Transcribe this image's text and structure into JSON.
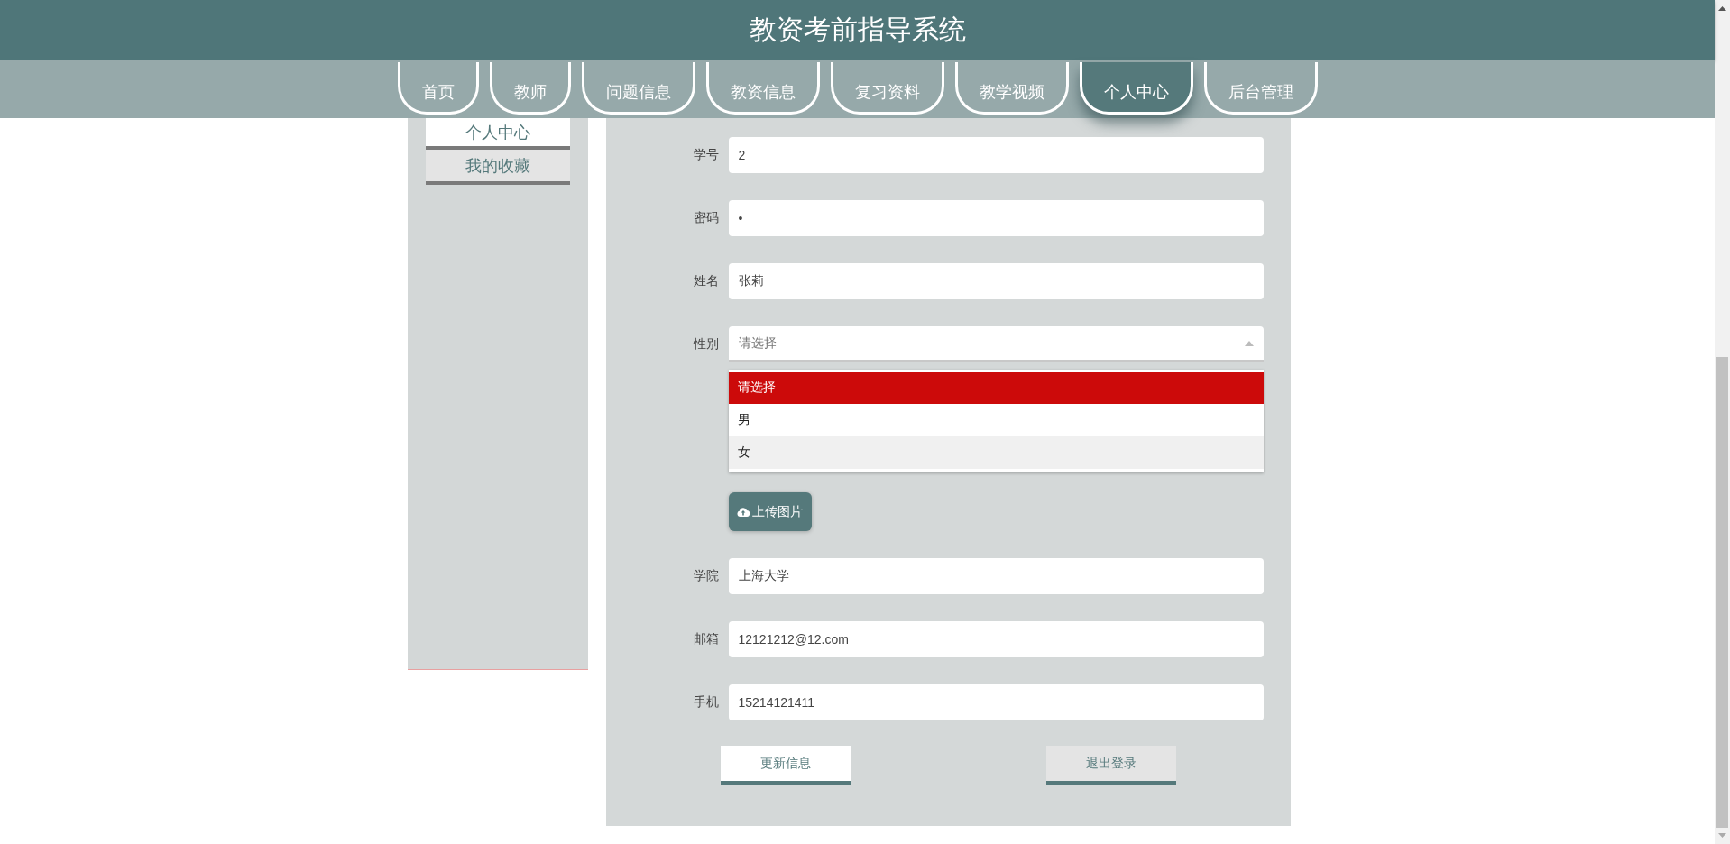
{
  "header": {
    "title": "教资考前指导系统"
  },
  "nav": [
    {
      "label": "首页",
      "selected": false
    },
    {
      "label": "教师",
      "selected": false
    },
    {
      "label": "问题信息",
      "selected": false
    },
    {
      "label": "教资信息",
      "selected": false
    },
    {
      "label": "复习资料",
      "selected": false
    },
    {
      "label": "教学视频",
      "selected": false
    },
    {
      "label": "个人中心",
      "selected": true
    },
    {
      "label": "后台管理",
      "selected": false
    }
  ],
  "sidebar": [
    {
      "label": "个人中心",
      "selected": true
    },
    {
      "label": "我的收藏",
      "selected": false
    }
  ],
  "form": {
    "fields": [
      {
        "kind": "text",
        "label": "学号",
        "value": "2"
      },
      {
        "kind": "text",
        "label": "密码",
        "value": "•"
      },
      {
        "kind": "text",
        "label": "姓名",
        "value": "张莉"
      },
      {
        "kind": "select",
        "label": "性别",
        "placeholder": "请选择",
        "expanded": true,
        "options": [
          {
            "label": "请选择",
            "selected": true,
            "hovered": false
          },
          {
            "label": "男",
            "selected": false,
            "hovered": false
          },
          {
            "label": "女",
            "selected": false,
            "hovered": true
          }
        ]
      },
      {
        "kind": "upload",
        "button": "上传图片"
      },
      {
        "kind": "text",
        "label": "学院",
        "value": "上海大学"
      },
      {
        "kind": "text",
        "label": "邮箱",
        "value": "12121212@12.com"
      },
      {
        "kind": "text",
        "label": "手机",
        "value": "15214121411"
      }
    ],
    "buttons": [
      {
        "label": "更新信息",
        "kind": "primary"
      },
      {
        "label": "退出登录",
        "kind": "secondary"
      }
    ]
  }
}
